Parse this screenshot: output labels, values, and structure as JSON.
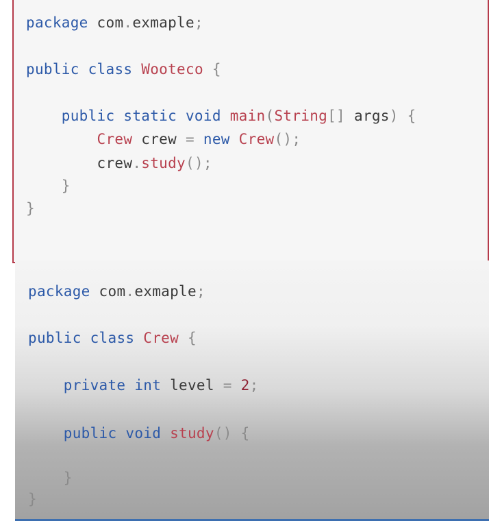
{
  "colors": {
    "keyword": "#2c59a8",
    "identifier": "#3a3a3a",
    "type_name": "#b8414f",
    "punctuation": "#8a8a8a",
    "number": "#8e1f31",
    "top_panel_border": "#b53a4a",
    "bottom_panel_border": "#3d6fb0"
  },
  "top_snippet": {
    "lines": [
      {
        "tokens": [
          {
            "t": "package",
            "c": "kw"
          },
          {
            "t": " com",
            "c": "id"
          },
          {
            "t": ".",
            "c": "pn"
          },
          {
            "t": "exmaple",
            "c": "id"
          },
          {
            "t": ";",
            "c": "pn"
          }
        ]
      },
      {
        "tokens": [
          {
            "t": "public",
            "c": "kw"
          },
          {
            "t": " class ",
            "c": "kw"
          },
          {
            "t": "Wooteco",
            "c": "ty"
          },
          {
            "t": " {",
            "c": "pn"
          }
        ]
      },
      {
        "tokens": [
          {
            "t": "    public",
            "c": "kw"
          },
          {
            "t": " static",
            "c": "kw"
          },
          {
            "t": " void",
            "c": "kw"
          },
          {
            "t": " main",
            "c": "ty"
          },
          {
            "t": "(",
            "c": "pn"
          },
          {
            "t": "String",
            "c": "ty"
          },
          {
            "t": "[]",
            "c": "pn"
          },
          {
            "t": " args",
            "c": "id"
          },
          {
            "t": ")",
            "c": "pn"
          },
          {
            "t": " {",
            "c": "pn"
          }
        ]
      },
      {
        "tokens": [
          {
            "t": "        Crew",
            "c": "ty"
          },
          {
            "t": " crew ",
            "c": "id"
          },
          {
            "t": "=",
            "c": "pn"
          },
          {
            "t": " new",
            "c": "kw"
          },
          {
            "t": " Crew",
            "c": "ty"
          },
          {
            "t": "();",
            "c": "pn"
          }
        ]
      },
      {
        "tokens": [
          {
            "t": "        crew",
            "c": "id"
          },
          {
            "t": ".",
            "c": "pn"
          },
          {
            "t": "study",
            "c": "ty"
          },
          {
            "t": "();",
            "c": "pn"
          }
        ]
      },
      {
        "tokens": [
          {
            "t": "    }",
            "c": "pn"
          }
        ]
      },
      {
        "tokens": [
          {
            "t": "}",
            "c": "pn"
          }
        ]
      }
    ]
  },
  "bottom_snippet": {
    "lines": [
      {
        "tokens": [
          {
            "t": "package",
            "c": "kw"
          },
          {
            "t": " com",
            "c": "id"
          },
          {
            "t": ".",
            "c": "pn"
          },
          {
            "t": "exmaple",
            "c": "id"
          },
          {
            "t": ";",
            "c": "pn"
          }
        ]
      },
      {
        "tokens": [
          {
            "t": "public",
            "c": "kw"
          },
          {
            "t": " class ",
            "c": "kw"
          },
          {
            "t": "Crew",
            "c": "ty"
          },
          {
            "t": " {",
            "c": "pn"
          }
        ]
      },
      {
        "tokens": [
          {
            "t": "    private",
            "c": "kw"
          },
          {
            "t": " int",
            "c": "kw"
          },
          {
            "t": " level ",
            "c": "id"
          },
          {
            "t": "=",
            "c": "pn"
          },
          {
            "t": " 2",
            "c": "nm"
          },
          {
            "t": ";",
            "c": "pn"
          }
        ]
      },
      {
        "tokens": [
          {
            "t": "    public",
            "c": "kw"
          },
          {
            "t": " void",
            "c": "kw"
          },
          {
            "t": " study",
            "c": "ty"
          },
          {
            "t": "()",
            "c": "pn"
          },
          {
            "t": " {",
            "c": "pn"
          }
        ]
      },
      {
        "tokens": [
          {
            "t": "    }",
            "c": "pn"
          }
        ]
      },
      {
        "tokens": [
          {
            "t": "}",
            "c": "pn"
          }
        ]
      }
    ]
  }
}
